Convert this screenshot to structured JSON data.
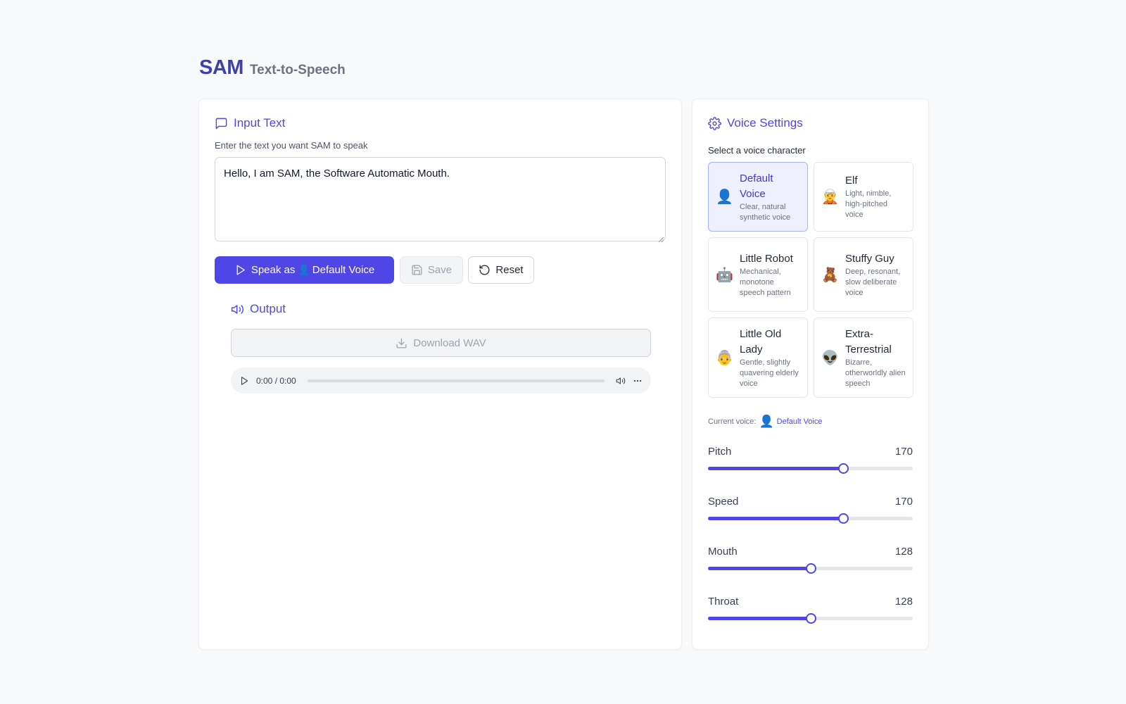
{
  "header": {
    "brand": "SAM",
    "subtitle": "Text-to-Speech"
  },
  "input": {
    "title": "Input Text",
    "description": "Enter the text you want SAM to speak",
    "value": "Hello, I am SAM, the Software Automatic Mouth."
  },
  "actions": {
    "speak_prefix": "Speak as",
    "speak_emoji": "👤",
    "speak_voice": "Default Voice",
    "save_label": "Save",
    "reset_label": "Reset"
  },
  "output": {
    "title": "Output",
    "download_label": "Download WAV",
    "time": "0:00 / 0:00"
  },
  "settings": {
    "title": "Voice Settings",
    "select_label": "Select a voice character",
    "voices": [
      {
        "emoji": "👤",
        "name": "Default Voice",
        "desc": "Clear, natural synthetic voice",
        "selected": true
      },
      {
        "emoji": "🧝",
        "name": "Elf",
        "desc": "Light, nimble, high-pitched voice",
        "selected": false
      },
      {
        "emoji": "🤖",
        "name": "Little Robot",
        "desc": "Mechanical, monotone speech pattern",
        "selected": false
      },
      {
        "emoji": "🧸",
        "name": "Stuffy Guy",
        "desc": "Deep, resonant, slow deliberate voice",
        "selected": false
      },
      {
        "emoji": "👵",
        "name": "Little Old Lady",
        "desc": "Gentle, slightly quavering elderly voice",
        "selected": false
      },
      {
        "emoji": "👽",
        "name": "Extra-Terrestrial",
        "desc": "Bizarre, otherworldly alien speech",
        "selected": false
      }
    ],
    "current_label": "Current voice:",
    "current_emoji": "👤",
    "current_name": "Default Voice",
    "sliders": [
      {
        "label": "Pitch",
        "value": "170",
        "fraction": 0.66
      },
      {
        "label": "Speed",
        "value": "170",
        "fraction": 0.66
      },
      {
        "label": "Mouth",
        "value": "128",
        "fraction": 0.5
      },
      {
        "label": "Throat",
        "value": "128",
        "fraction": 0.5
      }
    ]
  },
  "colors": {
    "accent": "#4f46e5",
    "brand": "#3f3fb0",
    "selected_bg": "#eef0fe"
  },
  "icons": {
    "input": "message-square-icon",
    "settings": "gear-icon",
    "output": "speaker-icon",
    "speak": "play-icon",
    "save": "floppy-disk-icon",
    "reset": "rotate-ccw-icon",
    "download": "download-icon"
  }
}
